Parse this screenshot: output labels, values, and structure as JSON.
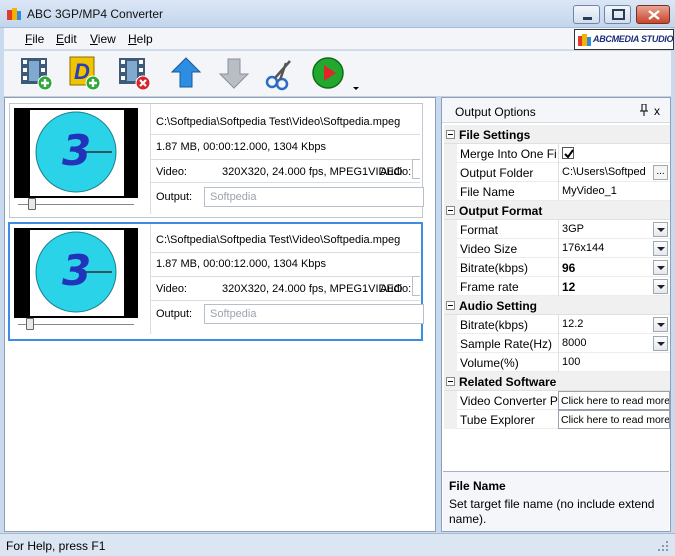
{
  "window": {
    "title": "ABC 3GP/MP4 Converter"
  },
  "menu": [
    {
      "key": "F",
      "rest": "ile"
    },
    {
      "key": "E",
      "rest": "dit"
    },
    {
      "key": "V",
      "rest": "iew"
    },
    {
      "key": "H",
      "rest": "elp"
    }
  ],
  "brand": {
    "text": "ABCMEDIA STUDIO"
  },
  "toolbar": {
    "icons": [
      "add-video-icon",
      "add-dvd-icon",
      "remove-video-icon",
      "move-up-icon",
      "move-down-icon",
      "settings-scissors-icon",
      "convert-play-icon"
    ]
  },
  "files": [
    {
      "path": "C:\\Softpedia\\Softpedia Test\\Video\\Softpedia.mpeg",
      "meta": "1.87 MB, 00:00:12.000, 1304 Kbps",
      "video_label": "Video:",
      "video_info": "320X320, 24.000 fps, MPEG1VIDEO",
      "audio_label": "Audio:",
      "output_label": "Output:",
      "output_placeholder": "Softpedia",
      "thumb_number": "3",
      "selected": false
    },
    {
      "path": "C:\\Softpedia\\Softpedia Test\\Video\\Softpedia.mpeg",
      "meta": "1.87 MB, 00:00:12.000, 1304 Kbps",
      "video_label": "Video:",
      "video_info": "320X320, 24.000 fps, MPEG1VIDEO",
      "audio_label": "Audio:",
      "output_label": "Output:",
      "output_placeholder": "Softpedia",
      "thumb_number": "3",
      "selected": true
    }
  ],
  "options": {
    "title": "Output Options",
    "close_glyph": "x",
    "categories": {
      "file_settings": "File Settings",
      "output_format": "Output Format",
      "audio_setting": "Audio Setting",
      "related_software": "Related Software"
    },
    "rows": {
      "merge": {
        "name": "Merge Into One Fi",
        "checked": true
      },
      "output_folder": {
        "name": "Output Folder",
        "value": "C:\\Users\\Softped"
      },
      "file_name": {
        "name": "File Name",
        "value": "MyVideo_1"
      },
      "format": {
        "name": "Format",
        "value": "3GP"
      },
      "video_size": {
        "name": "Video Size",
        "value": "176x144"
      },
      "video_bitrate": {
        "name": "Bitrate(kbps)",
        "value": "96"
      },
      "frame_rate": {
        "name": "Frame rate",
        "value": "12"
      },
      "audio_bitrate": {
        "name": "Bitrate(kbps)",
        "value": "12.2"
      },
      "sample_rate": {
        "name": "Sample Rate(Hz)",
        "value": "8000"
      },
      "volume": {
        "name": "Volume(%)",
        "value": "100"
      },
      "video_converter": {
        "name": "Video Converter P",
        "value": "Click here to read more"
      },
      "tube_explorer": {
        "name": "Tube Explorer",
        "value": "Click here to read more"
      }
    },
    "help": {
      "title": "File Name",
      "description": "Set target file name (no include extend name)."
    }
  },
  "status": {
    "text": "For Help, press F1"
  },
  "colors": {
    "selection": "#3d8ee0",
    "clock_face": "#2bd3e8",
    "clock_digit": "#2233bb"
  }
}
